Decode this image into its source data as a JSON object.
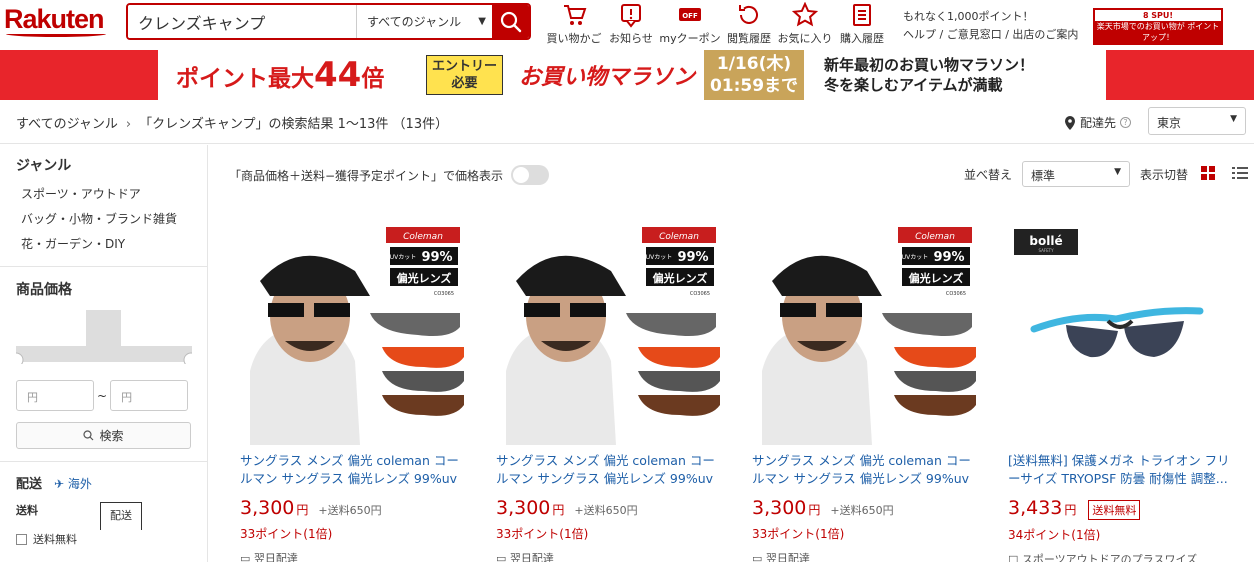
{
  "header": {
    "logo": "Rakuten",
    "search_value": "クレンズキャンプ",
    "genre_select": "すべてのジャンル",
    "nav": [
      {
        "icon": "shopping-cart-icon",
        "label": "買い物かご"
      },
      {
        "icon": "notification-icon",
        "label": "お知らせ"
      },
      {
        "icon": "coupon-icon",
        "label": "myクーポン"
      },
      {
        "icon": "history-icon",
        "label": "閲覧履歴"
      },
      {
        "icon": "star-icon",
        "label": "お気に入り"
      },
      {
        "icon": "purchase-history-icon",
        "label": "購入履歴"
      }
    ],
    "points_notice": "もれなく1,000ポイント！",
    "help_links": "ヘルプ / ご意見窓口 / 出店のご案内",
    "spu_top": "8 SPU!",
    "spu_text": "楽天市場でのお買い物が ポイントアップ！",
    "coupon_badge": "OFF"
  },
  "campaign": {
    "points_prefix": "ポイント最大",
    "points_value": "44",
    "points_suffix": "倍",
    "entry_line1": "エントリー",
    "entry_line2": "必要",
    "title": "お買い物マラソン",
    "date_line1": "1/16(木)",
    "date_line2": "01:59まで",
    "desc_line1": "新年最初のお買い物マラソン！",
    "desc_line2": "冬を楽しむアイテムが満載"
  },
  "breadcrumb": {
    "root": "すべてのジャンル",
    "separator": "›",
    "result": "「クレンズキャンプ」の検索結果 1〜13件 （13件）",
    "ship_to_label": "配達先",
    "help_mark": "?",
    "prefecture": "東京"
  },
  "sidebar": {
    "genre_heading": "ジャンル",
    "genres": [
      "スポーツ・アウトドア",
      "バッグ・小物・ブランド雑貨",
      "花・ガーデン・DIY"
    ],
    "price_heading": "商品価格",
    "price_min_placeholder": "円",
    "price_max_placeholder": "円",
    "price_tilde": "~",
    "search_button": "検索",
    "shipping_heading": "配送",
    "overseas_label": "海外",
    "shipping_fee_label": "送料",
    "delivery_tab": "配送",
    "free_shipping": "送料無料"
  },
  "toolbar": {
    "price_toggle_label": "「商品価格＋送料−獲得予定ポイント」で価格表示",
    "sort_label": "並べ替え",
    "sort_value": "標準",
    "view_label": "表示切替"
  },
  "products": [
    {
      "title": "サングラス メンズ 偏光 coleman コールマン サングラス 偏光レンズ 99%uvカ...",
      "price": "3,300",
      "yen": "円",
      "shipping": "+送料650円",
      "points": "33ポイント(1倍)",
      "extra": "翌日配達",
      "brand": "Coleman",
      "uv_prefix": "UVカット",
      "uv_value": "99%",
      "lens": "偏光レンズ",
      "code": "CO3065"
    },
    {
      "title": "サングラス メンズ 偏光 coleman コールマン サングラス 偏光レンズ 99%uvカ...",
      "price": "3,300",
      "yen": "円",
      "shipping": "+送料650円",
      "points": "33ポイント(1倍)",
      "extra": "翌日配達",
      "brand": "Coleman",
      "uv_prefix": "UVカット",
      "uv_value": "99%",
      "lens": "偏光レンズ",
      "code": "CO3065"
    },
    {
      "title": "サングラス メンズ 偏光 coleman コールマン サングラス 偏光レンズ 99%uvカ...",
      "price": "3,300",
      "yen": "円",
      "shipping": "+送料650円",
      "points": "33ポイント(1倍)",
      "extra": "翌日配達",
      "brand": "Coleman",
      "uv_prefix": "UVカット",
      "uv_value": "99%",
      "lens": "偏光レンズ",
      "code": "CO3065"
    },
    {
      "title": "[送料無料] 保護メガネ トライオン フリーサイズ TRYOPSF 防曇 耐傷性 調整...",
      "price": "3,433",
      "yen": "円",
      "free_badge": "送料無料",
      "points": "34ポイント(1倍)",
      "extra": "スポーツアウトドアのプラスワイズ",
      "brand": "bollé",
      "brand_sub": "SAFETY"
    }
  ],
  "colors": {
    "brand": "#bf0000",
    "link": "#1e5fa8",
    "banner_red": "#e8252b",
    "entry_yellow": "#ffe24f",
    "date_gold": "#c9a45a"
  }
}
